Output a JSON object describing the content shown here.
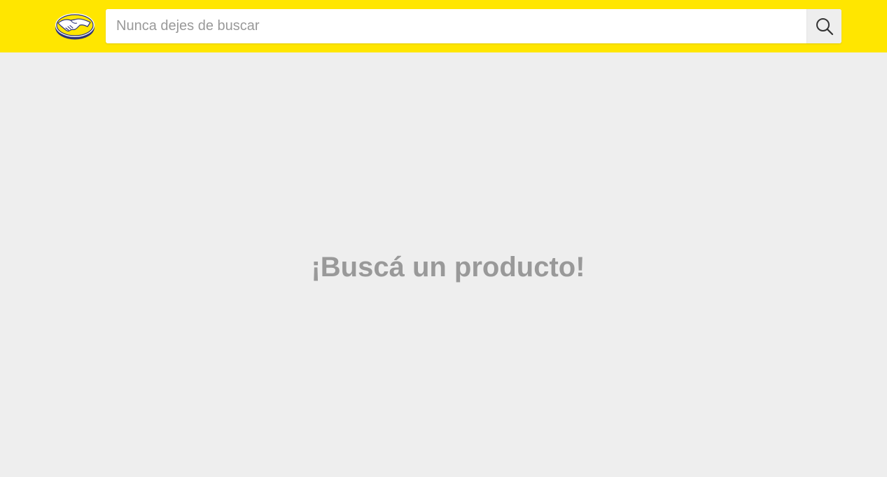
{
  "header": {
    "background_color": "#ffe600",
    "logo_icon": "handshake-logo-icon",
    "search": {
      "placeholder": "Nunca dejes de buscar",
      "value": "",
      "button_icon": "search-icon"
    }
  },
  "main": {
    "background_color": "#eeeeee",
    "prompt_text": "¡Buscá un producto!",
    "prompt_color": "#999999"
  }
}
